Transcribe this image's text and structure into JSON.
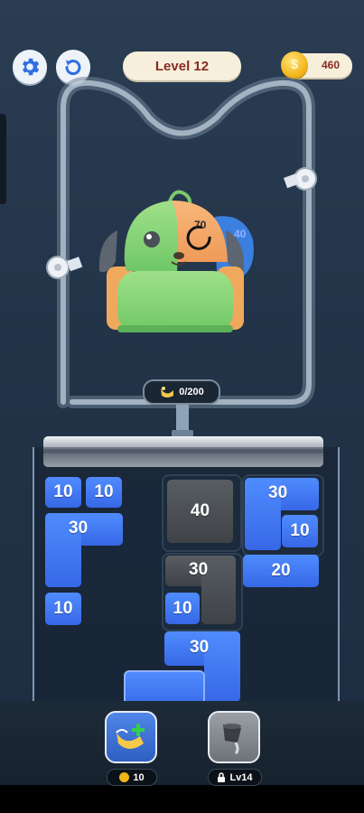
{
  "header": {
    "level_label": "Level 12",
    "coins": "460",
    "coin_symbol": "$"
  },
  "bag": {
    "progress_text": "0/200",
    "layer_labels": [
      "70",
      "40"
    ]
  },
  "blocks": [
    {
      "label": "10",
      "color": "blue"
    },
    {
      "label": "10",
      "color": "blue"
    },
    {
      "label": "30",
      "color": "blue"
    },
    {
      "label": "10",
      "color": "blue"
    },
    {
      "label": "40",
      "color": "gray"
    },
    {
      "label": "30",
      "color": "gray"
    },
    {
      "label": "10",
      "color": "blue"
    },
    {
      "label": "30",
      "color": "blue"
    },
    {
      "label": "30",
      "color": "blue"
    },
    {
      "label": "10",
      "color": "blue"
    },
    {
      "label": "20",
      "color": "blue"
    }
  ],
  "boosters": [
    {
      "name": "add-water",
      "cost": "10",
      "icon": "coin-icon"
    },
    {
      "name": "pour-bucket",
      "locked_label": "Lv14",
      "icon": "lock-icon"
    }
  ],
  "colors": {
    "block_blue": "#4f8cff",
    "block_gray": "#4a4e52",
    "level_text": "#8a2b1f",
    "background": "#223348"
  }
}
